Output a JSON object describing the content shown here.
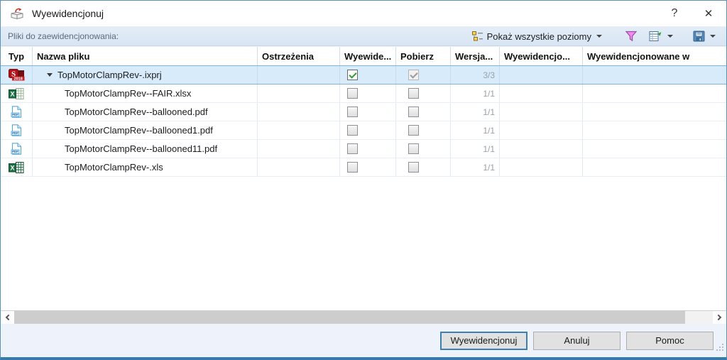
{
  "window": {
    "title": "Wyewidencjonuj",
    "help_glyph": "?",
    "close_glyph": "✕"
  },
  "toolbar": {
    "files_label": "Pliki do zaewidencjonowania:",
    "levels_button_label": "Pokaż wszystkie poziomy"
  },
  "table": {
    "columns": [
      "Typ",
      "Nazwa pliku",
      "Ostrzeżenia",
      "Wyewide...",
      "Pobierz",
      "Wersja...",
      "Wyewidencjo...",
      "Wyewidencjonowane w"
    ],
    "rows": [
      {
        "name": "TopMotorClampRev-.ixprj",
        "file_type": "inspection-project",
        "version": "3/3",
        "checkout_state": "checked",
        "get_state": "checked disabled",
        "selected": true,
        "expanded": true
      },
      {
        "name": "TopMotorClampRev--FAIR.xlsx",
        "file_type": "excel-xlsx",
        "version": "1/1",
        "checkout_state": "unchecked",
        "get_state": "unchecked",
        "selected": false
      },
      {
        "name": "TopMotorClampRev--ballooned.pdf",
        "file_type": "pdf",
        "version": "1/1",
        "checkout_state": "unchecked",
        "get_state": "unchecked",
        "selected": false
      },
      {
        "name": "TopMotorClampRev--ballooned1.pdf",
        "file_type": "pdf",
        "version": "1/1",
        "checkout_state": "unchecked",
        "get_state": "unchecked",
        "selected": false
      },
      {
        "name": "TopMotorClampRev--ballooned11.pdf",
        "file_type": "pdf",
        "version": "1/1",
        "checkout_state": "unchecked",
        "get_state": "unchecked",
        "selected": false
      },
      {
        "name": "TopMotorClampRev-.xls",
        "file_type": "excel-xls",
        "version": "1/1",
        "checkout_state": "unchecked",
        "get_state": "unchecked",
        "selected": false
      }
    ]
  },
  "buttons": {
    "checkout": "Wyewidencjonuj",
    "cancel": "Anuluj",
    "help": "Pomoc"
  },
  "colors": {
    "accent_blue": "#3c7fb1",
    "selected_row": "#d8ebfa",
    "toolbar_bg": "#dde8f5",
    "footer_bg": "#eef2fb",
    "filter_icon_pink": "#ee82ee",
    "check_green": "#2f9e2f",
    "version_gray": "#9aa0a6"
  }
}
